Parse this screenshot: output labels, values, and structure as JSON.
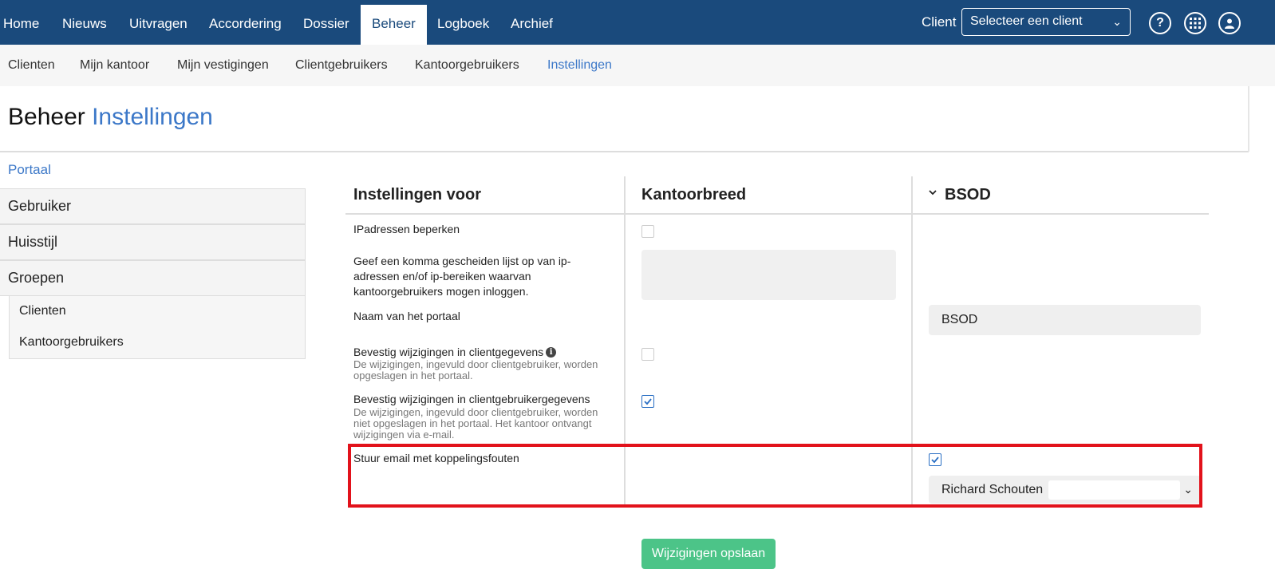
{
  "topnav": {
    "items": [
      "Home",
      "Nieuws",
      "Uitvragen",
      "Accordering",
      "Dossier",
      "Beheer",
      "Logboek",
      "Archief"
    ],
    "client_label": "Client",
    "client_select": "Selecteer een client",
    "icons": [
      "help-icon",
      "apps-grid-icon",
      "user-account-icon"
    ],
    "help_glyph": "?"
  },
  "subnav": {
    "items": [
      "Clienten",
      "Mijn kantoor",
      "Mijn vestigingen",
      "Clientgebruikers",
      "Kantoorgebruikers",
      "Instellingen"
    ],
    "active": "Instellingen"
  },
  "page": {
    "title_prefix": "Beheer",
    "title_accent": "Instellingen"
  },
  "sidemenu": {
    "section": "Portaal",
    "items": [
      "Gebruiker",
      "Huisstijl",
      "Groepen"
    ],
    "subitems": [
      "Clienten",
      "Kantoorgebruikers"
    ]
  },
  "settings": {
    "headers": {
      "setting": "Instellingen voor",
      "office": "Kantoorbreed",
      "client": "BSOD"
    },
    "rows": {
      "ip_restrict": {
        "label": "IPadressen beperken",
        "office_checked": false
      },
      "ip_list": {
        "label": "Geef een komma gescheiden lijst op van ip-adressen en/of ip-bereiken waarvan kantoorgebruikers mogen inloggen.",
        "office_value": ""
      },
      "portal_name": {
        "label": "Naam van het portaal",
        "client_value": "BSOD"
      },
      "confirm_client": {
        "label": "Bevestig wijzigingen in clientgegevens",
        "description": "De wijzigingen, ingevuld door clientgebruiker, worden opgeslagen in het portaal.",
        "office_checked": false
      },
      "confirm_clientuser": {
        "label": "Bevestig wijzigingen in clientgebruikergegevens",
        "description": "De wijzigingen, ingevuld door clientgebruiker, worden niet opgeslagen in het portaal. Het kantoor ontvangt wijzigingen via e-mail.",
        "office_checked": true
      },
      "email_errors": {
        "label": "Stuur email met koppelingsfouten",
        "client_checked": true,
        "client_recipient": "Richard Schouten"
      }
    },
    "save_label": "Wijzigingen opslaan"
  },
  "colors": {
    "nav_bg": "#1a4a7c",
    "accent": "#3c78c8",
    "save_button": "#4cc488",
    "highlight": "#e2121b"
  }
}
